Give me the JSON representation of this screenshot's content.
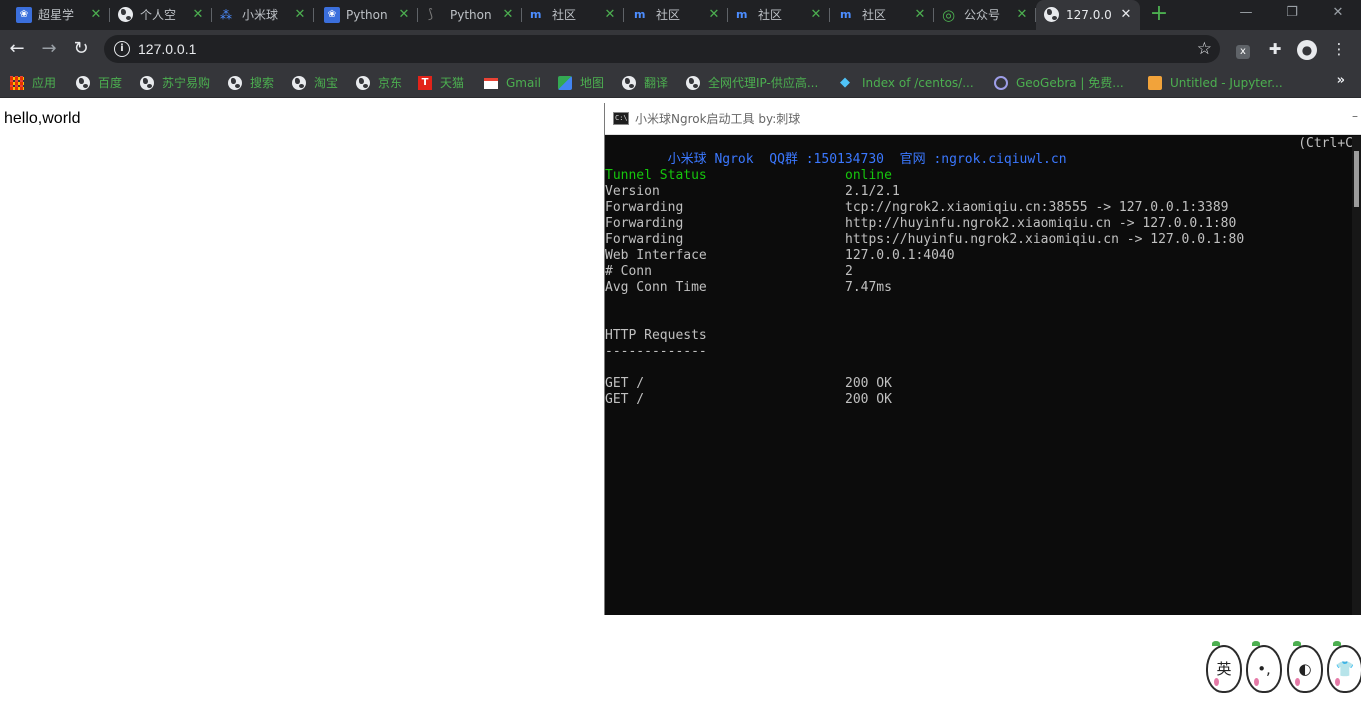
{
  "tabs": [
    {
      "title": "超星学",
      "icon": "baidu-paw-icon",
      "active": false
    },
    {
      "title": "个人空",
      "icon": "globe-icon",
      "active": false
    },
    {
      "title": "小米球",
      "icon": "xiaomiqiu-icon",
      "active": false
    },
    {
      "title": "Python",
      "icon": "baidu-paw-icon",
      "active": false
    },
    {
      "title": "Python",
      "icon": "python-icon",
      "active": false
    },
    {
      "title": "社区",
      "icon": "community-icon",
      "active": false
    },
    {
      "title": "社区",
      "icon": "community-icon",
      "active": false
    },
    {
      "title": "社区",
      "icon": "community-icon",
      "active": false
    },
    {
      "title": "社区",
      "icon": "community-icon",
      "active": false
    },
    {
      "title": "公众号",
      "icon": "wechat-icon",
      "active": false
    },
    {
      "title": "127.0.0",
      "icon": "globe-icon",
      "active": true
    }
  ],
  "toolbar": {
    "url": "127.0.0.1",
    "tab_close_glyph": "✕",
    "newtab_glyph": "+"
  },
  "bookmarks": [
    {
      "label": "应用",
      "icon": "apps-grid-icon"
    },
    {
      "label": "百度",
      "icon": "globe-icon"
    },
    {
      "label": "苏宁易购",
      "icon": "globe-icon"
    },
    {
      "label": "搜索",
      "icon": "globe-icon"
    },
    {
      "label": "淘宝",
      "icon": "globe-icon"
    },
    {
      "label": "京东",
      "icon": "globe-icon"
    },
    {
      "label": "天猫",
      "icon": "tmall-icon"
    },
    {
      "label": "Gmail",
      "icon": "gmail-icon"
    },
    {
      "label": "地图",
      "icon": "maps-icon"
    },
    {
      "label": "翻译",
      "icon": "globe-icon"
    },
    {
      "label": "全网代理IP-供应高...",
      "icon": "globe-icon"
    },
    {
      "label": "Index of /centos/...",
      "icon": "index-icon"
    },
    {
      "label": "GeoGebra | 免费...",
      "icon": "geogebra-icon"
    },
    {
      "label": "Untitled - Jupyter...",
      "icon": "jupyter-icon"
    }
  ],
  "page": {
    "body_text": "hello,world"
  },
  "console": {
    "title": "小米球Ngrok启动工具 by:刺球",
    "header_line": "小米球 Ngrok  QQ群 :150134730  官网 :ngrok.ciqiuwl.cn",
    "header_right": "(Ctrl+C",
    "status": [
      {
        "label": "Tunnel Status",
        "value": "online",
        "color": "#16c60c"
      },
      {
        "label": "Version",
        "value": "2.1/2.1"
      },
      {
        "label": "Forwarding",
        "value": "tcp://ngrok2.xiaomiqiu.cn:38555 -> 127.0.0.1:3389"
      },
      {
        "label": "Forwarding",
        "value": "http://huyinfu.ngrok2.xiaomiqiu.cn -> 127.0.0.1:80"
      },
      {
        "label": "Forwarding",
        "value": "https://huyinfu.ngrok2.xiaomiqiu.cn -> 127.0.0.1:80"
      },
      {
        "label": "Web Interface",
        "value": "127.0.0.1:4040"
      },
      {
        "label": "# Conn",
        "value": "2"
      },
      {
        "label": "Avg Conn Time",
        "value": "7.47ms"
      }
    ],
    "requests_heading": "HTTP Requests",
    "requests_rule": "-------------",
    "requests": [
      {
        "request": "GET /",
        "status": "200 OK"
      },
      {
        "request": "GET /",
        "status": "200 OK"
      }
    ]
  },
  "stickers": [
    {
      "text": "英",
      "icon": "sticker-ying-icon"
    },
    {
      "text": "•,",
      "icon": "sticker-comma-icon"
    },
    {
      "text": "◐",
      "icon": "sticker-moon-icon"
    },
    {
      "text": "👕",
      "icon": "sticker-shirt-icon"
    }
  ],
  "colors": {
    "tab_bg": "#202124",
    "toolbar_bg": "#35363a",
    "bookmark_text": "#4caf50",
    "console_bg": "#0c0c0c",
    "console_blue": "#3b78ff",
    "console_green": "#16c60c"
  }
}
